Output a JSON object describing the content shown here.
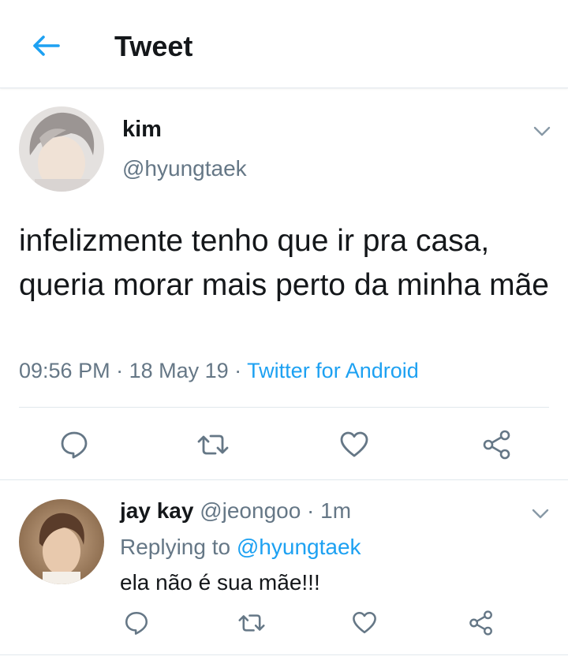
{
  "header": {
    "title": "Tweet"
  },
  "colors": {
    "accent": "#1da1f2",
    "secondary_text": "#657786",
    "primary_text": "#14171a",
    "divider": "#e1e8ed"
  },
  "tweet": {
    "display_name": "kim",
    "handle": "@hyungtaek",
    "text": "infelizmente tenho que ir pra casa, queria morar mais perto da minha mãe",
    "time": "09:56 PM",
    "date": "18 May 19",
    "source": "Twitter for Android",
    "separator": " · "
  },
  "reply": {
    "display_name": "jay kay",
    "handle": "@jeongoo",
    "age": "1m",
    "separator": " · ",
    "replying_prefix": "Replying to ",
    "replying_to": "@hyungtaek",
    "text": "ela não é sua mãe!!!"
  },
  "icons": [
    "back-arrow-icon",
    "chevron-down-icon",
    "reply-icon",
    "retweet-icon",
    "like-icon",
    "share-icon"
  ]
}
